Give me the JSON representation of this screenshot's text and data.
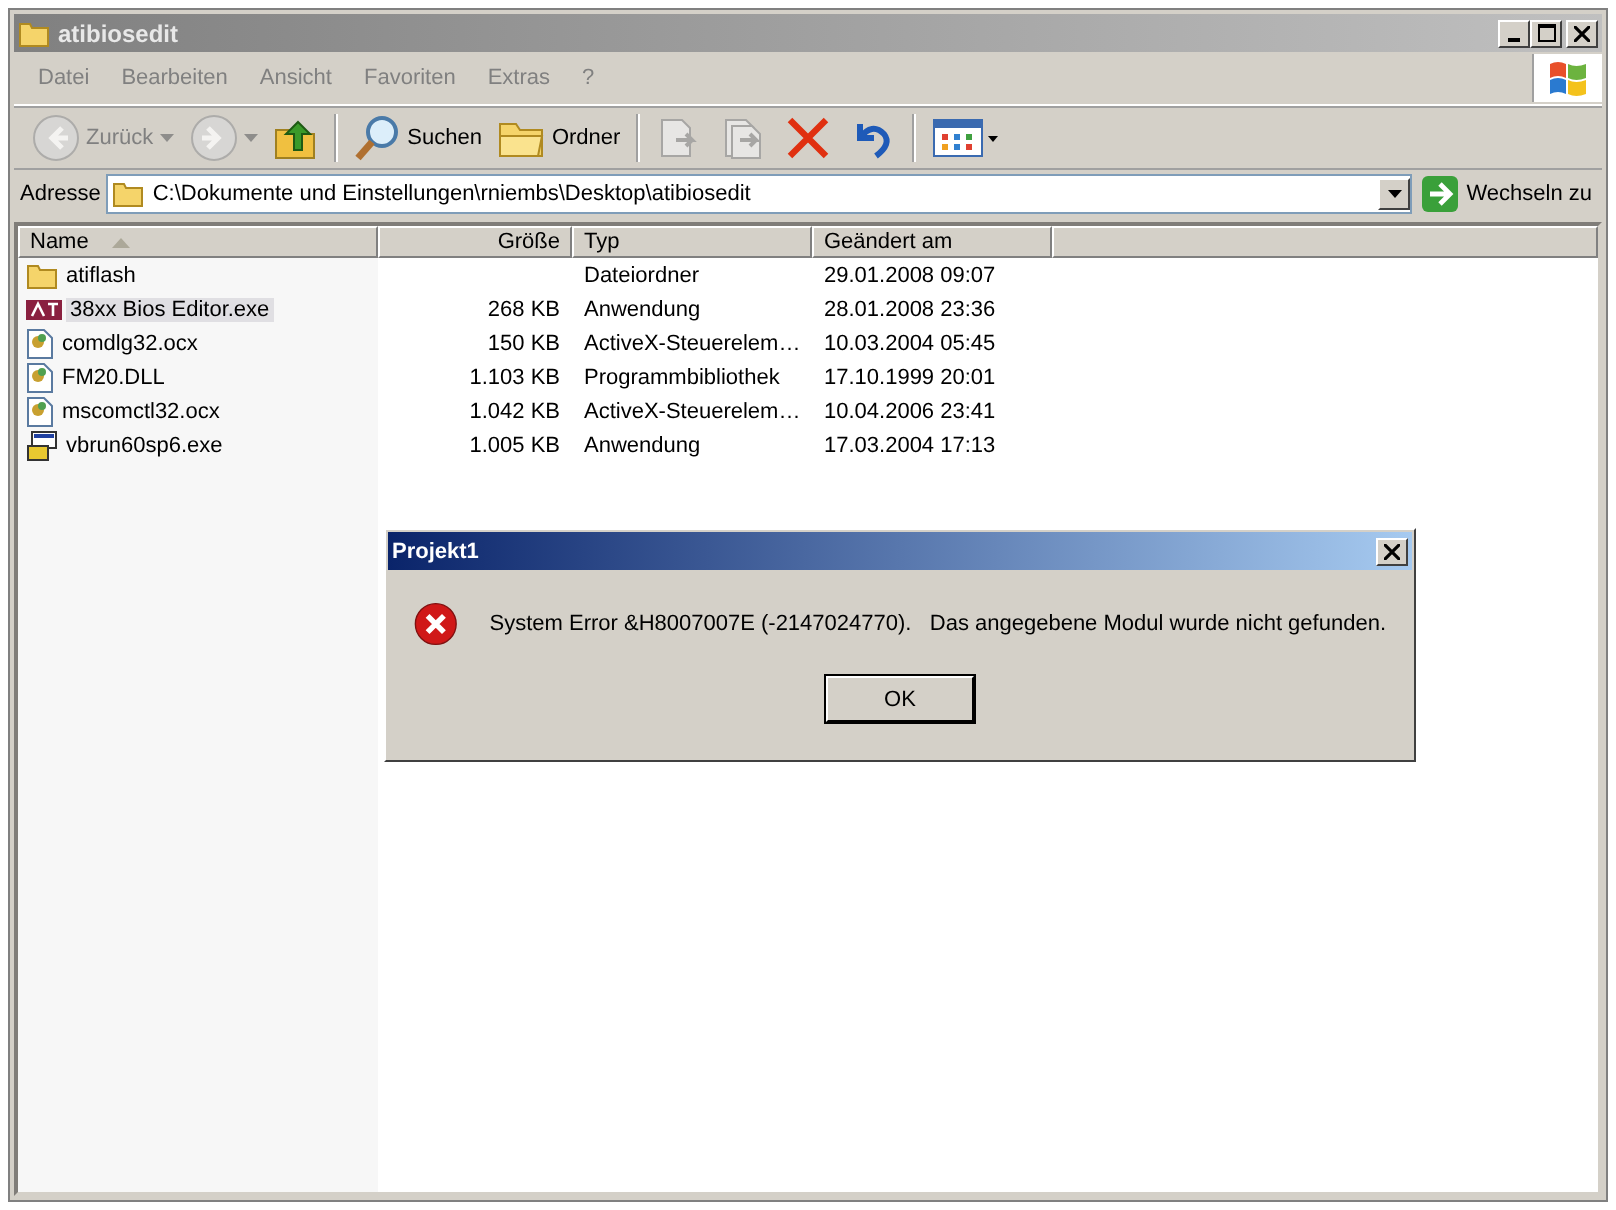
{
  "window": {
    "title": "atibiosedit"
  },
  "menu": [
    "Datei",
    "Bearbeiten",
    "Ansicht",
    "Favoriten",
    "Extras",
    "?"
  ],
  "toolbar": [
    {
      "kind": "back",
      "label": "Zurück",
      "disabled": true
    },
    {
      "kind": "forward",
      "disabled": true
    },
    {
      "kind": "up",
      "disabled": false
    },
    {
      "kind": "separator"
    },
    {
      "kind": "search",
      "label": "Suchen",
      "disabled": false
    },
    {
      "kind": "folders",
      "label": "Ordner",
      "disabled": false
    },
    {
      "kind": "separator"
    },
    {
      "kind": "move",
      "disabled": true
    },
    {
      "kind": "copy",
      "disabled": true
    },
    {
      "kind": "delete",
      "disabled": false
    },
    {
      "kind": "undo",
      "disabled": false
    },
    {
      "kind": "separator"
    },
    {
      "kind": "views",
      "disabled": false
    }
  ],
  "address": {
    "label": "Adresse",
    "value": "C:\\Dokumente und Einstellungen\\rniembs\\Desktop\\atibiosedit",
    "go": "Wechseln zu"
  },
  "table": {
    "columns": [
      {
        "label": "Name",
        "sorted": true
      },
      {
        "label": "Größe",
        "sorted": false
      },
      {
        "label": "Typ",
        "sorted": false
      },
      {
        "label": "Geändert am",
        "sorted": false
      }
    ],
    "rows": [
      {
        "kind": "folder",
        "name": "atiflash",
        "size": "",
        "type": "Dateiordner",
        "date": "29.01.2008 09:07",
        "selected": false
      },
      {
        "kind": "app",
        "name": "38xx Bios Editor.exe",
        "size": "268 KB",
        "type": "Anwendung",
        "date": "28.01.2008 23:36",
        "selected": true
      },
      {
        "kind": "library",
        "name": "comdlg32.ocx",
        "size": "150 KB",
        "type": "ActiveX-Steuerelem…",
        "date": "10.03.2004 05:45",
        "selected": false
      },
      {
        "kind": "library",
        "name": "FM20.DLL",
        "size": "1.103 KB",
        "type": "Programmbibliothek",
        "date": "17.10.1999 20:01",
        "selected": false
      },
      {
        "kind": "library",
        "name": "mscomctl32.ocx",
        "size": "1.042 KB",
        "type": "ActiveX-Steuerelem…",
        "date": "10.04.2006 23:41",
        "selected": false
      },
      {
        "kind": "setup",
        "name": "vbrun60sp6.exe",
        "size": "1.005 KB",
        "type": "Anwendung",
        "date": "17.03.2004 17:13",
        "selected": false
      }
    ]
  },
  "dialog": {
    "title": "Projekt1",
    "message": "System Error &H8007007E (-2147024770).   Das angegebene Modul wurde nicht gefunden.",
    "button": "OK"
  }
}
